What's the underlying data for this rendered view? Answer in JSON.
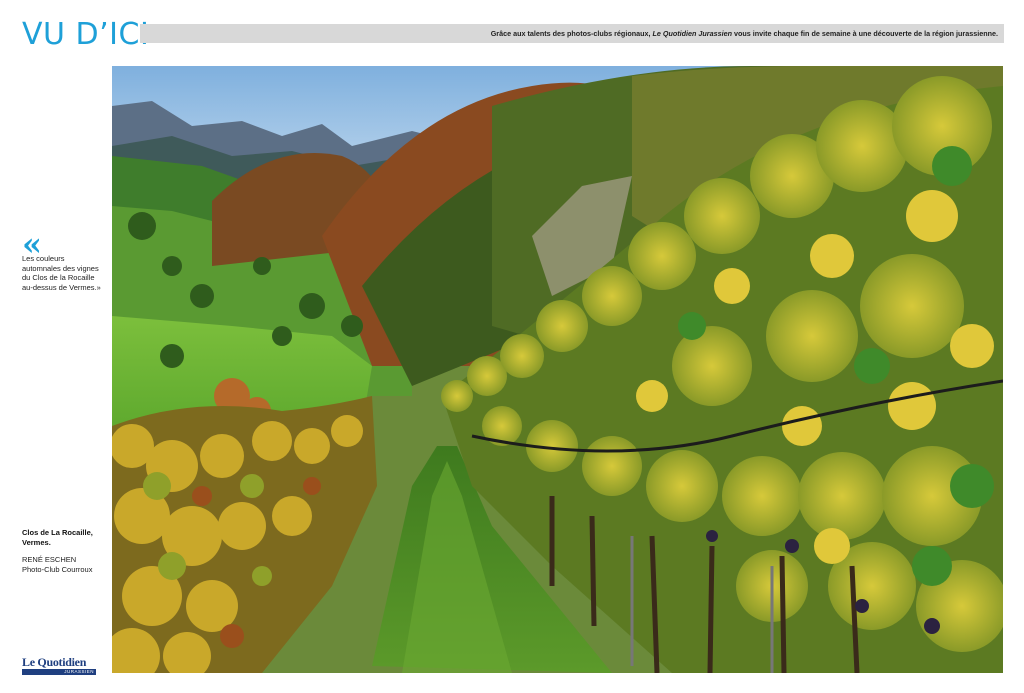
{
  "header": {
    "title": "VU D’ICI",
    "tagline_before": "Grâce aux talents des photos-clubs régionaux, ",
    "tagline_publication": "Le Quotidien Jurassien",
    "tagline_after": " vous invite chaque fin de semaine à une découverte de la région jurassienne."
  },
  "quote": {
    "mark": "«",
    "text": "Les couleurs automnales des vignes du Clos de la Rocaille au-dessus de Vermes.»"
  },
  "caption": {
    "title": "Clos de La Rocaille, Vermes.",
    "photographer": "RENÉ ESCHEN",
    "club": "Photo-Club Courroux"
  },
  "logo": {
    "name": "Le Quotidien",
    "sub": "JURASSIEN"
  },
  "colors": {
    "accent": "#1ea0d8",
    "header_bar": "#d8d8d8",
    "logo_blue": "#1f3f80"
  }
}
